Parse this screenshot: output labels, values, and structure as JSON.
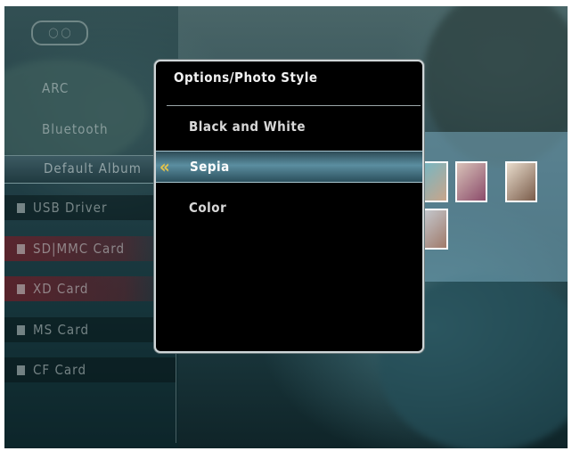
{
  "background_menu": {
    "logo": "",
    "items": [
      {
        "label": "ARC",
        "icon": "none"
      },
      {
        "label": "Bluetooth",
        "icon": "none"
      },
      {
        "label": "Default Album",
        "icon": "none",
        "selected": true
      },
      {
        "label": "USB Driver",
        "icon": "usb-icon"
      },
      {
        "label": "SD|MMC Card",
        "icon": "card-icon"
      },
      {
        "label": "XD Card",
        "icon": "card-icon"
      },
      {
        "label": "MS Card",
        "icon": "card-icon"
      },
      {
        "label": "CF Card",
        "icon": "card-icon"
      }
    ]
  },
  "dialog": {
    "title": "Options/Photo Style",
    "options": [
      {
        "label": "Black and White",
        "selected": false
      },
      {
        "label": "Sepia",
        "selected": true
      },
      {
        "label": "Color",
        "selected": false
      }
    ],
    "selected_marker_icon": "double-chevron-left-icon",
    "accent_color": "#e6c44a"
  }
}
